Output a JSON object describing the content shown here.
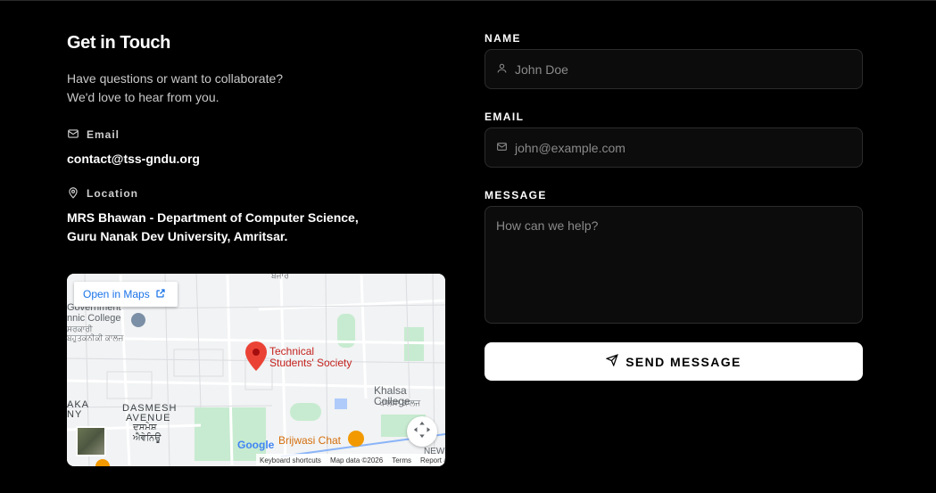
{
  "contact": {
    "title": "Get in Touch",
    "subtitle_line1": "Have questions or want to collaborate?",
    "subtitle_line2": "We'd love to hear from you.",
    "email_label": "Email",
    "email_value": "contact@tss-gndu.org",
    "location_label": "Location",
    "location_line1": "MRS Bhawan - Department of Computer Science,",
    "location_line2": "Guru Nanak Dev University, Amritsar."
  },
  "map": {
    "open_in_maps": "Open in Maps",
    "pin_label_line1": "Technical",
    "pin_label_line2": "Students' Society",
    "place_govt_1": "Government",
    "place_govt_2": "nnic College",
    "place_govt_3": "ਸਰਕਾਰੀ",
    "place_govt_4": "ਬਹੁਤਕਨੀਕੀ ਕਾਲਜ",
    "place_top": "ਬਜਾਰ",
    "place_khalsa_1": "Khalsa College",
    "place_khalsa_2": "ਖਾਲਸਾ ਕਾਲਜ",
    "place_dasmesh_1": "DASMESH",
    "place_dasmesh_2": "AVENUE",
    "place_dasmesh_3": "ਦਸਮੇਸ਼",
    "place_dasmesh_4": "ਐਵੇਨਿਊ",
    "place_left_1": "AKA",
    "place_left_2": "NY",
    "place_new": "NEW",
    "place_brijwasi": "Brijwasi Chat",
    "google_logo": "Google",
    "footer_shortcuts": "Keyboard shortcuts",
    "footer_mapdata": "Map data ©2026",
    "footer_terms": "Terms",
    "footer_report": "Report a map error"
  },
  "form": {
    "name_label": "NAME",
    "name_placeholder": "John Doe",
    "email_label": "EMAIL",
    "email_placeholder": "john@example.com",
    "message_label": "MESSAGE",
    "message_placeholder": "How can we help?",
    "send_label": "SEND MESSAGE"
  },
  "colors": {
    "background": "#000000",
    "link_blue": "#1a73e8",
    "pin_red": "#ea4335"
  }
}
